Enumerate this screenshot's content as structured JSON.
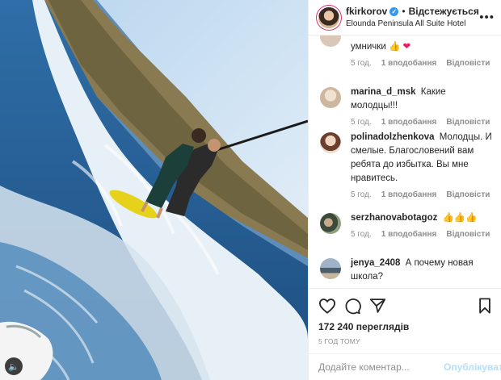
{
  "header": {
    "username": "fkirkorov",
    "separator": "•",
    "follow_status": "Відстежується",
    "location": "Elounda Peninsula All Suite Hotel"
  },
  "comments": [
    {
      "user": "",
      "text": "умнички",
      "emoji": "👍",
      "heart": "❤",
      "age": "5 год.",
      "likes": "1 вподобання",
      "reply": "Відповісти"
    },
    {
      "user": "marina_d_msk",
      "text": "Какие молодцы!!!",
      "age": "5 год.",
      "likes": "1 вподобання",
      "reply": "Відповісти"
    },
    {
      "user": "polinadolzhenkova",
      "text": "Молодцы. И смелые. Благословений вам ребята до избытка. Вы мне нравитесь.",
      "age": "5 год.",
      "likes": "1 вподобання",
      "reply": "Відповісти"
    },
    {
      "user": "serzhanovabotagoz",
      "text": "",
      "emoji": "👍👍👍",
      "age": "5 год.",
      "likes": "1 вподобання",
      "reply": "Відповісти"
    },
    {
      "user": "jenya_2408",
      "text": "А почему новая школа?"
    }
  ],
  "stats": {
    "views": "172 240 переглядів",
    "time_ago": "5 ГОД ТОМУ"
  },
  "comment_box": {
    "placeholder": "Додайте коментар...",
    "publish_label": "Опублікувати"
  },
  "colors": {
    "accent_blue": "#3897f0",
    "publish_disabled": "#b2dffc",
    "muted_text": "#8e8e8e"
  }
}
